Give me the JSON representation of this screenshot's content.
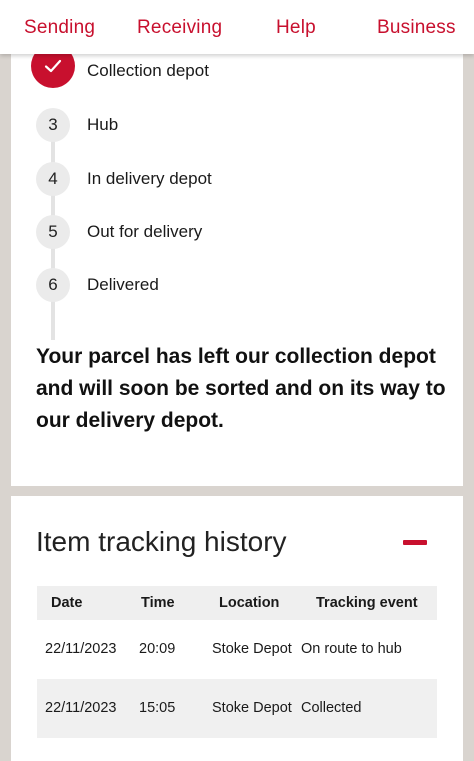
{
  "nav": {
    "items": [
      "Sending",
      "Receiving",
      "Help",
      "Business"
    ]
  },
  "steps": {
    "current": {
      "label": "Collection depot",
      "icon": "check-icon"
    },
    "upcoming": [
      {
        "number": "3",
        "label": "Hub"
      },
      {
        "number": "4",
        "label": "In delivery depot"
      },
      {
        "number": "5",
        "label": "Out for delivery"
      },
      {
        "number": "6",
        "label": "Delivered"
      }
    ]
  },
  "status_message": "Your parcel has left our collection depot and will soon be sorted and on its way to our delivery depot.",
  "history": {
    "title": "Item tracking history",
    "columns": [
      "Date",
      "Time",
      "Location",
      "Tracking event"
    ],
    "rows": [
      {
        "date": "22/11/2023",
        "time": "20:09",
        "location": "Stoke Depot",
        "event": "On route to hub"
      },
      {
        "date": "22/11/2023",
        "time": "15:05",
        "location": "Stoke Depot",
        "event": "Collected"
      }
    ]
  },
  "colors": {
    "brand_red": "#c8102e",
    "background": "#d9d4cf"
  }
}
